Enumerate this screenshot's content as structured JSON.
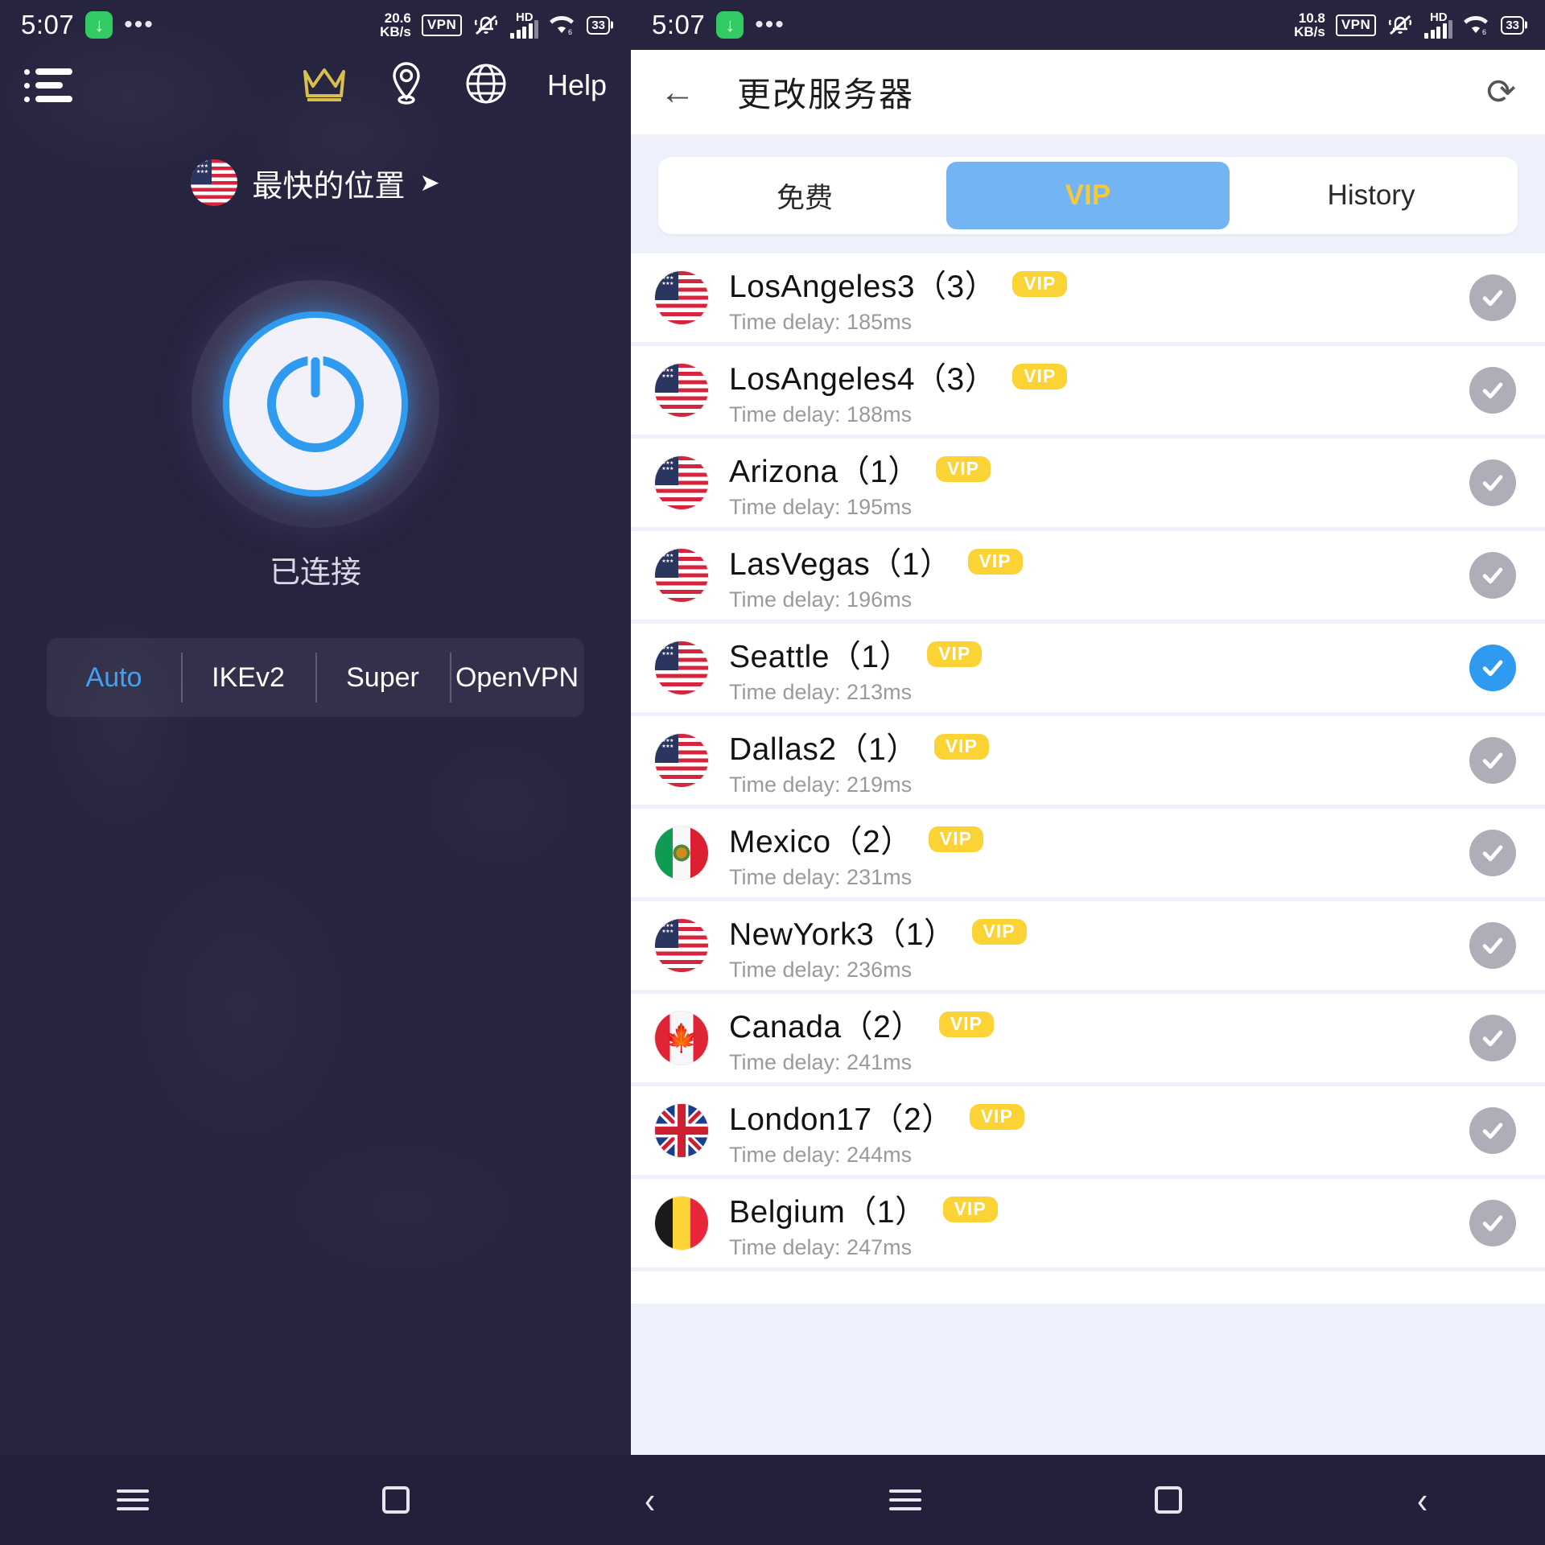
{
  "left_panel": {
    "status_bar": {
      "time": "5:07",
      "download_icon": "download-arrow-icon",
      "overflow_dots": "•••",
      "net_speed": "20.6",
      "net_speed_unit": "KB/s",
      "vpn_label": "VPN",
      "mute_icon": "bell-muted-icon",
      "hd_label": "HD",
      "signal_icon": "signal-bars-icon",
      "wifi_icon": "wifi-icon",
      "battery": "33"
    },
    "toolbar": {
      "menu_icon": "list-menu-icon",
      "crown_icon": "crown-icon",
      "location_icon": "location-pin-icon",
      "globe_icon": "globe-icon",
      "help_label": "Help"
    },
    "location": {
      "flag": "us-flag",
      "label": "最快的位置",
      "arrow": "➤"
    },
    "power": {
      "icon": "power-button-icon",
      "status_label": "已连接"
    },
    "protocols": {
      "selected": "Auto",
      "items": [
        {
          "label": "Auto",
          "active": true
        },
        {
          "label": "IKEv2",
          "active": false
        },
        {
          "label": "Super",
          "active": false
        },
        {
          "label": "OpenVPN",
          "active": false
        }
      ]
    }
  },
  "right_panel": {
    "status_bar": {
      "time": "5:07",
      "download_icon": "download-arrow-icon",
      "overflow_dots": "•••",
      "net_speed": "10.8",
      "net_speed_unit": "KB/s",
      "vpn_label": "VPN",
      "mute_icon": "bell-muted-icon",
      "hd_label": "HD",
      "signal_icon": "signal-bars-icon",
      "wifi_icon": "wifi-icon",
      "battery": "33"
    },
    "header": {
      "back_icon": "back-arrow-icon",
      "title": "更改服务器",
      "refresh_icon": "refresh-icon"
    },
    "tabs": [
      {
        "label": "免费",
        "active": false
      },
      {
        "label": "VIP",
        "active": true
      },
      {
        "label": "History",
        "active": false
      }
    ],
    "delay_prefix": "Time delay: ",
    "vip_badge_label": "VIP",
    "servers": [
      {
        "flag": "us",
        "name": "LosAngeles3（3）",
        "vip": "VIP",
        "delay": "Time delay: 185ms",
        "selected": false
      },
      {
        "flag": "us",
        "name": "LosAngeles4（3）",
        "vip": "VIP",
        "delay": "Time delay: 188ms",
        "selected": false
      },
      {
        "flag": "us",
        "name": "Arizona（1）",
        "vip": "VIP",
        "delay": "Time delay: 195ms",
        "selected": false
      },
      {
        "flag": "us",
        "name": "LasVegas（1）",
        "vip": "VIP",
        "delay": "Time delay: 196ms",
        "selected": false
      },
      {
        "flag": "us",
        "name": "Seattle（1）",
        "vip": "VIP",
        "delay": "Time delay: 213ms",
        "selected": true
      },
      {
        "flag": "us",
        "name": "Dallas2（1）",
        "vip": "VIP",
        "delay": "Time delay: 219ms",
        "selected": false
      },
      {
        "flag": "mx",
        "name": "Mexico（2）",
        "vip": "VIP",
        "delay": "Time delay: 231ms",
        "selected": false
      },
      {
        "flag": "us",
        "name": "NewYork3（1）",
        "vip": "VIP",
        "delay": "Time delay: 236ms",
        "selected": false
      },
      {
        "flag": "ca",
        "name": "Canada（2）",
        "vip": "VIP",
        "delay": "Time delay: 241ms",
        "selected": false
      },
      {
        "flag": "gb",
        "name": "London17（2）",
        "vip": "VIP",
        "delay": "Time delay: 244ms",
        "selected": false
      },
      {
        "flag": "be",
        "name": "Belgium（1）",
        "vip": "VIP",
        "delay": "Time delay: 247ms",
        "selected": false
      }
    ]
  },
  "navbar": {
    "recents_icon": "recents-icon",
    "home_icon": "home-icon",
    "back_icon": "back-icon"
  },
  "colors": {
    "accent_blue": "#2e9bf0",
    "vip_yellow": "#fbd335",
    "panel_dark": "#272440",
    "list_bg": "#eef1fb"
  }
}
